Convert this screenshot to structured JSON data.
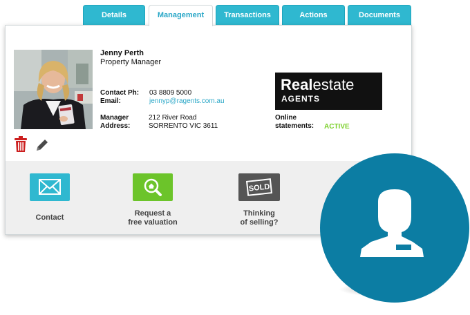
{
  "tabs": [
    {
      "label": "Details",
      "active": false
    },
    {
      "label": "Management",
      "active": true
    },
    {
      "label": "Transactions",
      "active": false
    },
    {
      "label": "Actions",
      "active": false
    },
    {
      "label": "Documents",
      "active": false
    }
  ],
  "agent": {
    "name": "Jenny Perth",
    "role": "Property Manager",
    "contact_ph_label": "Contact Ph:",
    "contact_ph": "03 8809 5000",
    "email_label": "Email:",
    "email": "jennyp@ragents.com.au",
    "manager_label": "Manager",
    "address_label": "Address:",
    "address_line1": "212 River Road",
    "address_line2": "SORRENTO VIC 3611"
  },
  "brand": {
    "logo_real": "Real",
    "logo_estate": "estate",
    "logo_agents": "AGENTS"
  },
  "statements": {
    "label_line1": "Online",
    "label_line2": "statements:",
    "status": "ACTIVE",
    "status_color": "#7bd02a"
  },
  "actions": [
    {
      "label_line1": "Contact",
      "label_line2": "",
      "icon": "envelope-icon",
      "color": "#2fb8d0"
    },
    {
      "label_line1": "Request a",
      "label_line2": "free valuation",
      "icon": "house-search-icon",
      "color": "#6cc42a"
    },
    {
      "label_line1": "Thinking",
      "label_line2": "of selling?",
      "icon": "sold-sign-icon",
      "color": "#555555",
      "sign_text": "SOLD"
    }
  ],
  "colors": {
    "accent": "#2fb8d0",
    "circle": "#0c7da3",
    "delete": "#cc1f1f"
  }
}
